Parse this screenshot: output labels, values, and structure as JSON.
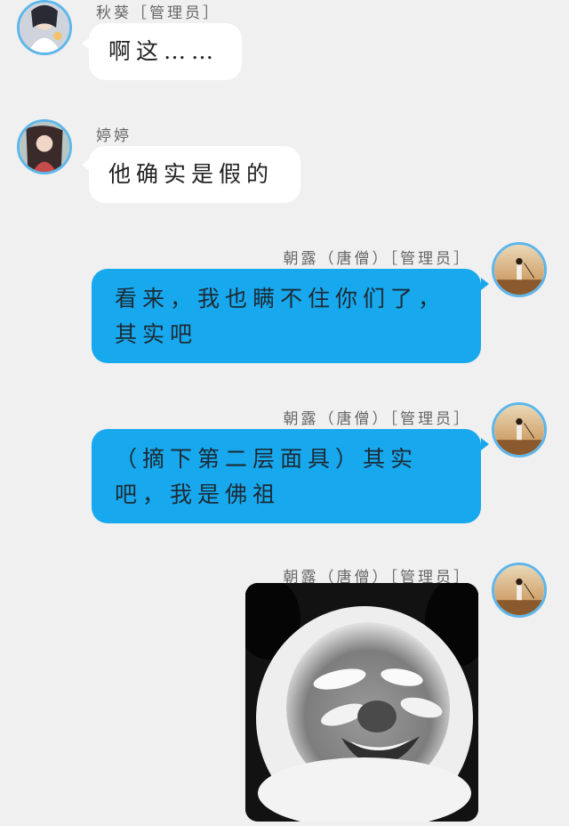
{
  "messages": [
    {
      "sender": "秋葵",
      "role": "［管理员］",
      "text": "啊这……"
    },
    {
      "sender": "婷婷",
      "text": "他确实是假的"
    },
    {
      "sender": "朝露",
      "sender_alias": "（唐僧）",
      "role": "［管理员］",
      "text": "看来，我也瞒不住你们了，其实吧"
    },
    {
      "sender": "朝露",
      "sender_alias": "（唐僧）",
      "role": "［管理员］",
      "text": "（摘下第二层面具）其实吧，我是佛祖"
    },
    {
      "sender": "朝露",
      "sender_alias": "（唐僧）",
      "role": "［管理员］",
      "sticker": "panda-meme-face"
    }
  ],
  "colors": {
    "background": "#f0f0f0",
    "self_bubble": "#17a8ee",
    "other_bubble": "#ffffff",
    "avatar_ring": "#5eb6ea"
  }
}
